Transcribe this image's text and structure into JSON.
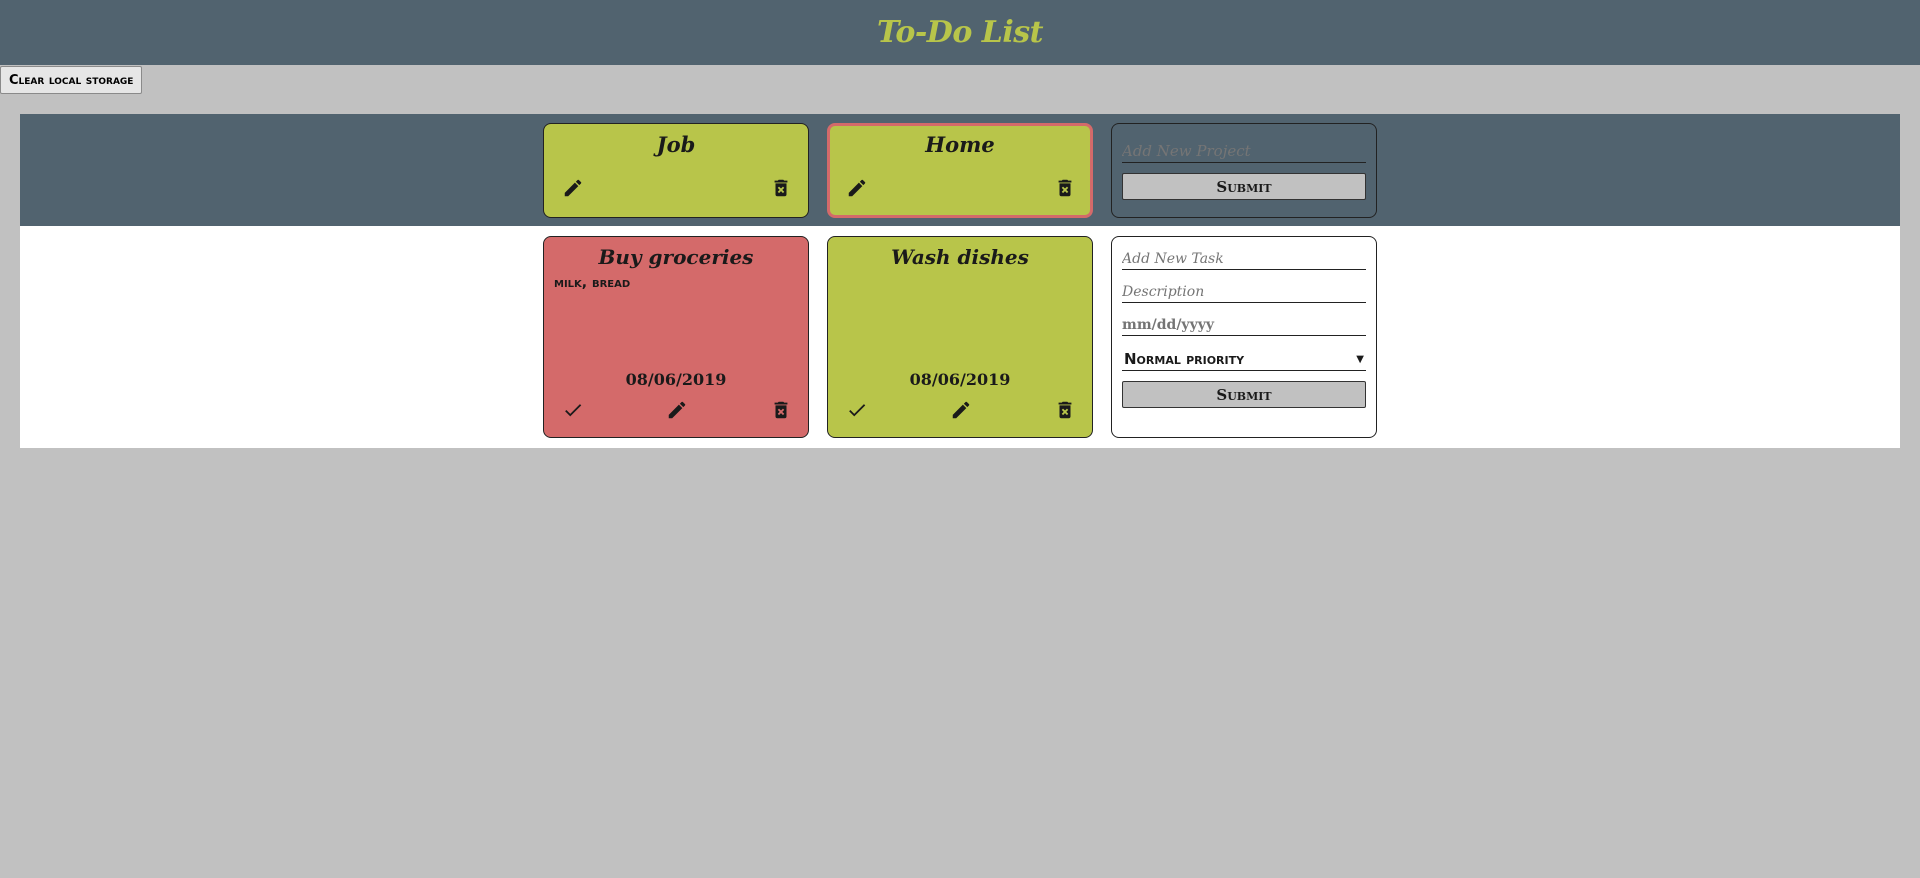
{
  "app": {
    "title": "To-Do List"
  },
  "toolbar": {
    "clear_label": "Clear local storage"
  },
  "colors": {
    "accent": "#b8c54a",
    "band": "#51636f",
    "urgent": "#d46a6a",
    "page": "#c1c1c1"
  },
  "projects": [
    {
      "name": "Job",
      "selected": false,
      "icons": [
        "pencil-icon",
        "trash-icon"
      ]
    },
    {
      "name": "Home",
      "selected": true,
      "icons": [
        "pencil-icon",
        "trash-icon"
      ]
    }
  ],
  "new_project": {
    "placeholder": "Add New Project",
    "submit_label": "Submit"
  },
  "tasks": [
    {
      "title": "Buy groceries",
      "description": "milk, bread",
      "date": "08/06/2019",
      "color": "#d46a6a"
    },
    {
      "title": "Wash dishes",
      "description": "",
      "date": "08/06/2019",
      "color": "#b8c54a"
    }
  ],
  "new_task": {
    "title_placeholder": "Add New Task",
    "description_placeholder": "Description",
    "date_placeholder": "mm/dd/yyyy",
    "priority_value": "Normal priority",
    "submit_label": "Submit"
  }
}
